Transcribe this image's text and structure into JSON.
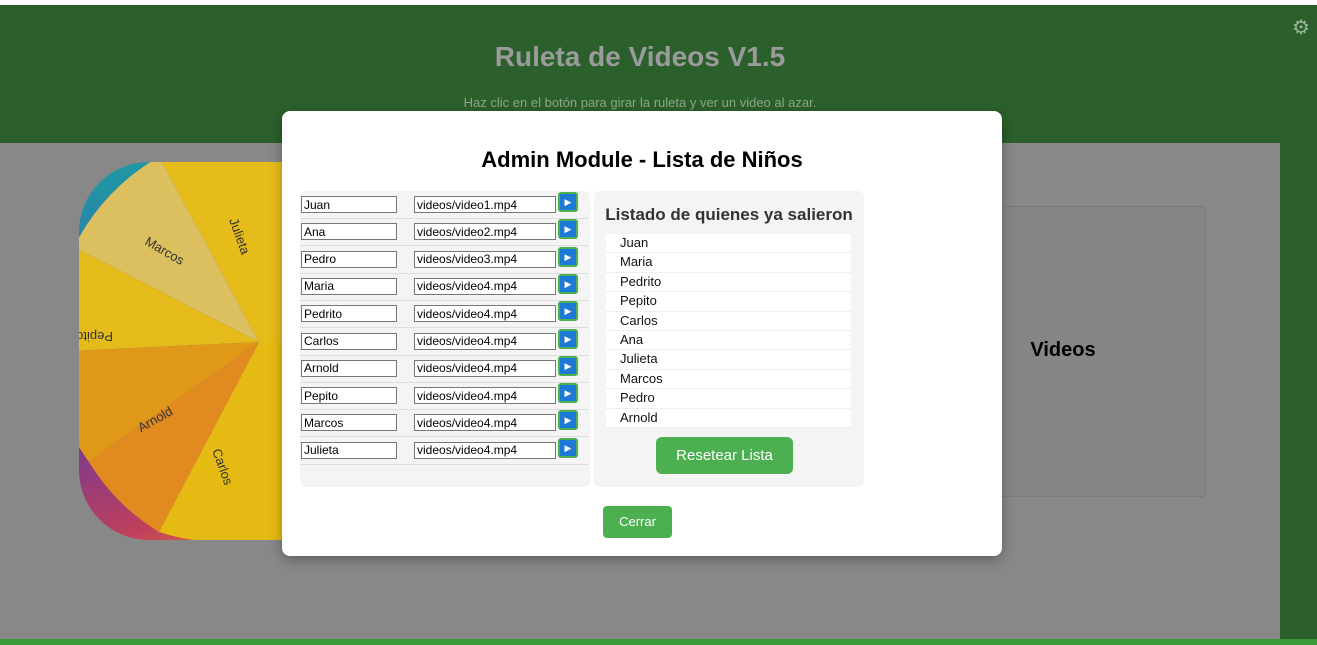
{
  "header": {
    "title": "Ruleta de Videos V1.5",
    "subtitle": "Haz clic en el botón para girar la ruleta y ver un video al azar."
  },
  "sidebar": {
    "settings_icon": "gear-icon"
  },
  "wheel": {
    "labels": [
      "Julieta",
      "Marcos",
      "Pepito",
      "Arnold",
      "Carlos"
    ]
  },
  "videos_panel": {
    "label": "Videos"
  },
  "modal": {
    "title": "Admin Module - Lista de Niños",
    "kids": [
      {
        "name": "Juan",
        "video": "videos/video1.mp4"
      },
      {
        "name": "Ana",
        "video": "videos/video2.mp4"
      },
      {
        "name": "Pedro",
        "video": "videos/video3.mp4"
      },
      {
        "name": "Maria",
        "video": "videos/video4.mp4"
      },
      {
        "name": "Pedrito",
        "video": "videos/video4.mp4"
      },
      {
        "name": "Carlos",
        "video": "videos/video4.mp4"
      },
      {
        "name": "Arnold",
        "video": "videos/video4.mp4"
      },
      {
        "name": "Pepito",
        "video": "videos/video4.mp4"
      },
      {
        "name": "Marcos",
        "video": "videos/video4.mp4"
      },
      {
        "name": "Julieta",
        "video": "videos/video4.mp4"
      }
    ],
    "out_title": "Listado de quienes ya salieron",
    "out_list": [
      "Juan",
      "Maria",
      "Pedrito",
      "Pepito",
      "Carlos",
      "Ana",
      "Julieta",
      "Marcos",
      "Pedro",
      "Arnold"
    ],
    "reset_label": "Resetear Lista",
    "close_label": "Cerrar",
    "play_icon": "play-icon"
  },
  "colors": {
    "header_bg": "#2b5f2b",
    "accent": "#4caf50",
    "play_blue": "#1d79d6"
  }
}
